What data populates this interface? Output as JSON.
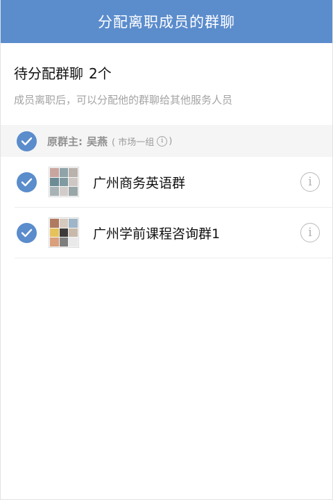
{
  "title": "分配离职成员的群聊",
  "header": {
    "pending_label": "待分配群聊",
    "pending_count": "2个",
    "hint": "成员离职后，可以分配他的群聊给其他服务人员"
  },
  "owner": {
    "label": "原群主:",
    "name": "吴燕",
    "team": "( 市场一组",
    "team_close": ")",
    "info_icon": "info-icon",
    "checked": true
  },
  "groups": [
    {
      "name": "广州商务英语群",
      "checked": true,
      "avatar_colors": [
        "#c9a5a0",
        "#8fa4a8",
        "#b9b2ad",
        "#6b8b95",
        "#7f9aa0",
        "#cfc7c4",
        "#a8b3b6",
        "#d1ccca",
        "#9aa7a9"
      ]
    },
    {
      "name": "广州学前课程咨询群1",
      "checked": true,
      "avatar_colors": [
        "#b07a60",
        "#d6c9bd",
        "#9fb5c8",
        "#e6c25a",
        "#3d3b3a",
        "#c8b9aa",
        "#d9a07b",
        "#7e7e7e",
        "#e9e9e9"
      ]
    }
  ],
  "icons": {
    "check": "check-icon",
    "info": "info-icon"
  }
}
